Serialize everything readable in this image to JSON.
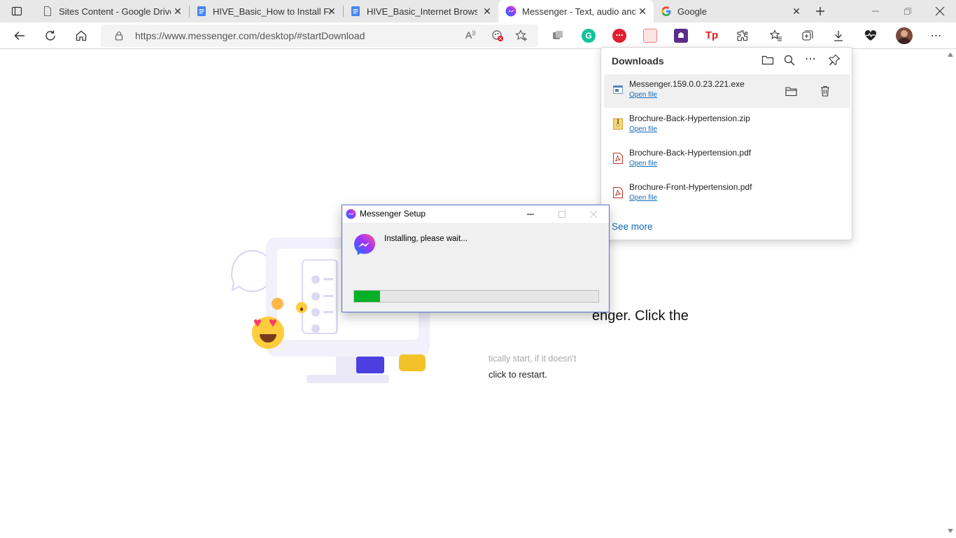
{
  "tabs": [
    {
      "title": "Sites Content - Google Drive",
      "icon": "document-icon"
    },
    {
      "title": "HIVE_Basic_How to Install Fac",
      "icon": "google-docs-icon"
    },
    {
      "title": "HIVE_Basic_Internet Browsing",
      "icon": "google-docs-icon"
    },
    {
      "title": "Messenger - Text, audio and v",
      "icon": "messenger-icon",
      "active": true
    },
    {
      "title": "Google",
      "icon": "google-icon"
    }
  ],
  "address_bar": {
    "url": "https://www.messenger.com/desktop/#startDownload"
  },
  "page": {
    "heading": "enger. Click the",
    "subtext": "tically start, if it doesn't",
    "restart_link": "click to restart."
  },
  "downloads": {
    "title": "Downloads",
    "items": [
      {
        "name": "Messenger.159.0.0.23.221.exe",
        "action": "Open file",
        "type": "exe"
      },
      {
        "name": "Brochure-Back-Hypertension.zip",
        "action": "Open file",
        "type": "zip"
      },
      {
        "name": "Brochure-Back-Hypertension.pdf",
        "action": "Open file",
        "type": "pdf"
      },
      {
        "name": "Brochure-Front-Hypertension.pdf",
        "action": "Open file",
        "type": "pdf"
      }
    ],
    "see_more": "See more"
  },
  "setup_dialog": {
    "title": "Messenger Setup",
    "message": "Installing, please wait...",
    "progress": 0.105
  },
  "colors": {
    "progress": "#06b025",
    "link": "#0f6cbd",
    "messenger_gradient_start": "#0a7cff",
    "messenger_gradient_end": "#ff4aa0"
  }
}
